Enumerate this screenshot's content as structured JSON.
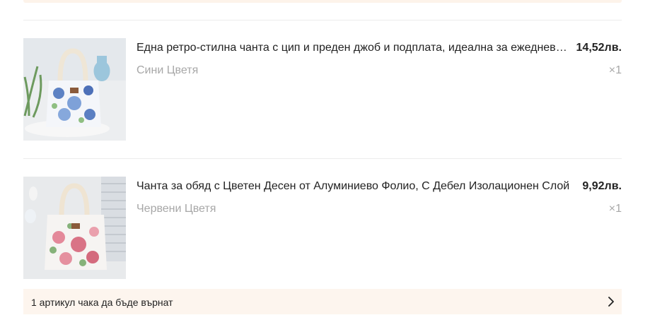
{
  "items": [
    {
      "title": "Една ретро-стилна чанта с цип и преден джоб и подплата, идеална за ежедневна употреба",
      "price": "14,52лв.",
      "variant": "Сини Цветя",
      "quantity": "×1",
      "image_icon": "floral-lunch-bag-blue-image"
    },
    {
      "title": "Чанта за обяд с Цветен Десен от Алуминиево Фолио, С Дебел Изолационен Слой",
      "price": "9,92лв.",
      "variant": "Червени Цветя",
      "quantity": "×1",
      "image_icon": "floral-lunch-bag-red-image"
    }
  ],
  "return_notice": {
    "text": "1 артикул чака да бъде върнат",
    "icon": "chevron-right-icon"
  },
  "colors": {
    "accent_bg": "#fdf5ee",
    "muted_text": "#a7a7a7"
  }
}
